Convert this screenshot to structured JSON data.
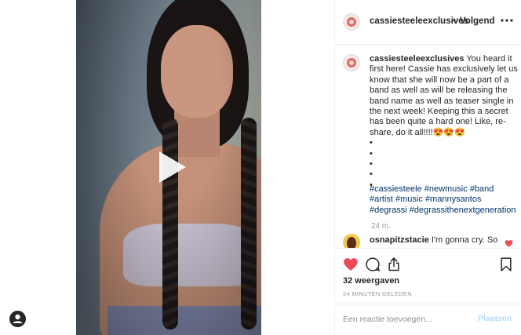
{
  "post": {
    "username": "cassiesteeleexclusives",
    "separator": "•",
    "follow_label": "Volgend",
    "more_icon": "more-horizontal-icon"
  },
  "caption": {
    "username": "cassiesteeleexclusives",
    "text": "You heard it first here! Cassie has exclusively let us know that she will now be a part of a band as well as will be releasing the band name as well as teaser single in the next week! Keeping this a secret has been quite a hard one! Like, re-share, do it all!!!!😍😍😍",
    "bullets": [
      "•",
      "•",
      "•",
      "•",
      "•"
    ],
    "hashtags": [
      "#cassiesteele",
      "#newmusic",
      "#band",
      "#artist",
      "#music",
      "#mannysantos",
      "#degrassi",
      "#degrassithenextgeneration"
    ],
    "time": "24 m."
  },
  "comment": {
    "username": "osnapitzstacie",
    "text": "I'm gonna cry. So"
  },
  "actions": {
    "views": "32 weergaven",
    "time_ago": "24 MINUTEN GELEDEN"
  },
  "add_comment": {
    "placeholder": "Een reactie toevoegen...",
    "post_label": "Plaatsen"
  },
  "colors": {
    "like_red": "#ed4956",
    "link_blue": "#003569",
    "post_button_disabled": "#b3dbff"
  }
}
